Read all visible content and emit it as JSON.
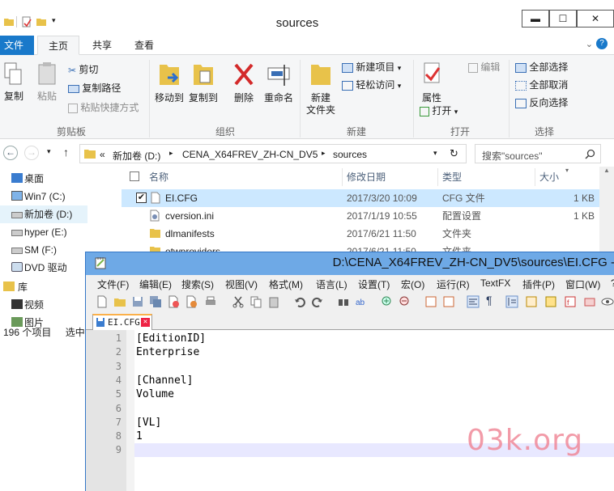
{
  "explorer": {
    "title": "sources",
    "window_buttons": {
      "minimize": "▬",
      "maximize": "☐",
      "close": "✕"
    },
    "ribbon_tabs": [
      "文件",
      "主页",
      "共享",
      "查看"
    ],
    "ribbon": {
      "clipboard": {
        "label": "剪贴板",
        "copy": "复制",
        "paste": "粘贴",
        "cut": "剪切",
        "copy_path": "复制路径",
        "paste_shortcut": "粘贴快捷方式"
      },
      "organize": {
        "label": "组织",
        "move_to": "移动到",
        "copy_to": "复制到",
        "delete": "删除",
        "rename": "重命名"
      },
      "new": {
        "label": "新建",
        "new_folder_line1": "新建",
        "new_folder_line2": "文件夹",
        "new_item": "新建项目",
        "easy_access": "轻松访问"
      },
      "open": {
        "label": "打开",
        "properties": "属性",
        "open": "打开",
        "edit": "编辑"
      },
      "select": {
        "label": "选择",
        "select_all": "全部选择",
        "select_none": "全部取消",
        "invert": "反向选择"
      }
    },
    "address": {
      "prefix": "«",
      "crumbs": [
        "新加卷 (D:)",
        "CENA_X64FREV_ZH-CN_DV5",
        "sources"
      ],
      "search_placeholder": "搜索\"sources\""
    },
    "nav_items": [
      {
        "label": "桌面",
        "icon": "desktop-icon"
      },
      {
        "label": "Win7 (C:)",
        "icon": "drive-icon"
      },
      {
        "label": "新加卷 (D:)",
        "icon": "drive-icon"
      },
      {
        "label": "hyper (E:)",
        "icon": "drive-icon"
      },
      {
        "label": "SM (F:)",
        "icon": "drive-icon"
      },
      {
        "label": "DVD 驱动",
        "icon": "dvd-icon"
      },
      {
        "label": "库",
        "icon": "library-icon"
      },
      {
        "label": "视频",
        "icon": "video-icon"
      },
      {
        "label": "图片",
        "icon": "picture-icon"
      }
    ],
    "columns": {
      "name": "名称",
      "modified": "修改日期",
      "type": "类型",
      "size": "大小"
    },
    "files": [
      {
        "name": "EI.CFG",
        "modified": "2017/3/20 10:09",
        "type": "CFG 文件",
        "size": "1 KB"
      },
      {
        "name": "cversion.ini",
        "modified": "2017/1/19 10:55",
        "type": "配置设置",
        "size": "1 KB"
      },
      {
        "name": "dlmanifests",
        "modified": "2017/6/21 11:50",
        "type": "文件夹",
        "size": ""
      },
      {
        "name": "etwproviders",
        "modified": "2017/6/21 11:50",
        "type": "文件夹",
        "size": ""
      }
    ],
    "status": {
      "count": "196 个项目",
      "selected": "选中"
    }
  },
  "npp": {
    "title": "D:\\CENA_X64FREV_ZH-CN_DV5\\sources\\EI.CFG -",
    "menu": [
      "文件(F)",
      "编辑(E)",
      "搜索(S)",
      "视图(V)",
      "格式(M)",
      "语言(L)",
      "设置(T)",
      "宏(O)",
      "运行(R)",
      "TextFX",
      "插件(P)",
      "窗口(W)",
      "?"
    ],
    "tab_label": "EI.CFG",
    "lines": [
      "[EditionID]",
      "Enterprise",
      "",
      "[Channel]",
      "Volume",
      "",
      "[VL]",
      "1",
      ""
    ],
    "line_numbers": [
      "1",
      "2",
      "3",
      "4",
      "5",
      "6",
      "7",
      "8",
      "9"
    ]
  },
  "watermark": "03k.org",
  "colors": {
    "accent": "#1979ca",
    "npp_title": "#6ea9e6",
    "selection": "#cce8ff",
    "watermark": "#f08a9a"
  }
}
